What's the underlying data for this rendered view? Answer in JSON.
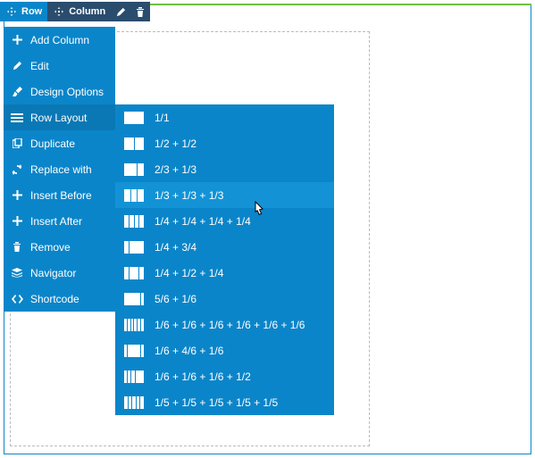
{
  "toolbar": {
    "row_label": "Row",
    "column_label": "Column"
  },
  "menu": [
    {
      "icon": "plus",
      "label": "Add Column"
    },
    {
      "icon": "pencil",
      "label": "Edit"
    },
    {
      "icon": "brush",
      "label": "Design Options"
    },
    {
      "icon": "lines",
      "label": "Row Layout"
    },
    {
      "icon": "copy",
      "label": "Duplicate"
    },
    {
      "icon": "refresh",
      "label": "Replace with"
    },
    {
      "icon": "plus",
      "label": "Insert Before"
    },
    {
      "icon": "plus",
      "label": "Insert After"
    },
    {
      "icon": "trash",
      "label": "Remove"
    },
    {
      "icon": "stack",
      "label": "Navigator"
    },
    {
      "icon": "code",
      "label": "Shortcode"
    }
  ],
  "layouts": [
    {
      "label": "1/1",
      "cols": [
        1
      ]
    },
    {
      "label": "1/2 + 1/2",
      "cols": [
        1,
        1
      ]
    },
    {
      "label": "2/3 + 1/3",
      "cols": [
        2,
        1
      ]
    },
    {
      "label": "1/3 + 1/3 + 1/3",
      "cols": [
        1,
        1,
        1
      ]
    },
    {
      "label": "1/4 + 1/4 + 1/4 + 1/4",
      "cols": [
        1,
        1,
        1,
        1
      ]
    },
    {
      "label": "1/4 + 3/4",
      "cols": [
        1,
        3
      ]
    },
    {
      "label": "1/4 + 1/2 + 1/4",
      "cols": [
        1,
        2,
        1
      ]
    },
    {
      "label": "5/6 + 1/6",
      "cols": [
        5,
        1
      ]
    },
    {
      "label": "1/6 + 1/6 + 1/6 + 1/6 + 1/6 + 1/6",
      "cols": [
        1,
        1,
        1,
        1,
        1,
        1
      ]
    },
    {
      "label": "1/6 + 4/6 + 1/6",
      "cols": [
        1,
        4,
        1
      ]
    },
    {
      "label": "1/6 + 1/6 + 1/6 + 1/2",
      "cols": [
        1,
        1,
        1,
        3
      ]
    },
    {
      "label": "1/5 + 1/5 + 1/5 + 1/5 + 1/5",
      "cols": [
        1,
        1,
        1,
        1,
        1
      ]
    }
  ],
  "active_menu_index": 3,
  "hover_layout_index": 3
}
